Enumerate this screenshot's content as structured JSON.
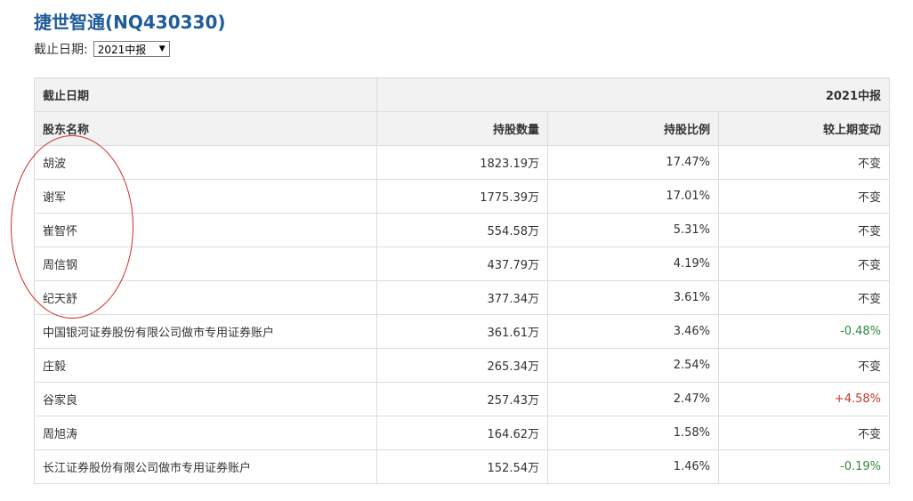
{
  "title": "捷世智通(NQ430330)",
  "date_filter": {
    "label": "截止日期:",
    "selected": "2021中报"
  },
  "table": {
    "header1": {
      "label": "截止日期",
      "period": "2021中报"
    },
    "header2": {
      "name": "股东名称",
      "shares": "持股数量",
      "ratio": "持股比例",
      "change": "较上期变动"
    },
    "rows": [
      {
        "name": "胡波",
        "shares": "1823.19万",
        "ratio": "17.47%",
        "change": "不变",
        "change_type": "same"
      },
      {
        "name": "谢军",
        "shares": "1775.39万",
        "ratio": "17.01%",
        "change": "不变",
        "change_type": "same"
      },
      {
        "name": "崔智怀",
        "shares": "554.58万",
        "ratio": "5.31%",
        "change": "不变",
        "change_type": "same"
      },
      {
        "name": "周信钢",
        "shares": "437.79万",
        "ratio": "4.19%",
        "change": "不变",
        "change_type": "same"
      },
      {
        "name": "纪天舒",
        "shares": "377.34万",
        "ratio": "3.61%",
        "change": "不变",
        "change_type": "same"
      },
      {
        "name": "中国银河证券股份有限公司做市专用证券账户",
        "shares": "361.61万",
        "ratio": "3.46%",
        "change": "-0.48%",
        "change_type": "neg"
      },
      {
        "name": "庄毅",
        "shares": "265.34万",
        "ratio": "2.54%",
        "change": "不变",
        "change_type": "same"
      },
      {
        "name": "谷家良",
        "shares": "257.43万",
        "ratio": "2.47%",
        "change": "+4.58%",
        "change_type": "pos"
      },
      {
        "name": "周旭涛",
        "shares": "164.62万",
        "ratio": "1.58%",
        "change": "不变",
        "change_type": "same"
      },
      {
        "name": "长江证券股份有限公司做市专用证券账户",
        "shares": "152.54万",
        "ratio": "1.46%",
        "change": "-0.19%",
        "change_type": "neg"
      }
    ]
  },
  "colors": {
    "title": "#1f5c99",
    "negative": "#2e8b3a",
    "positive": "#c0392b",
    "annotation": "#d42a2a"
  }
}
